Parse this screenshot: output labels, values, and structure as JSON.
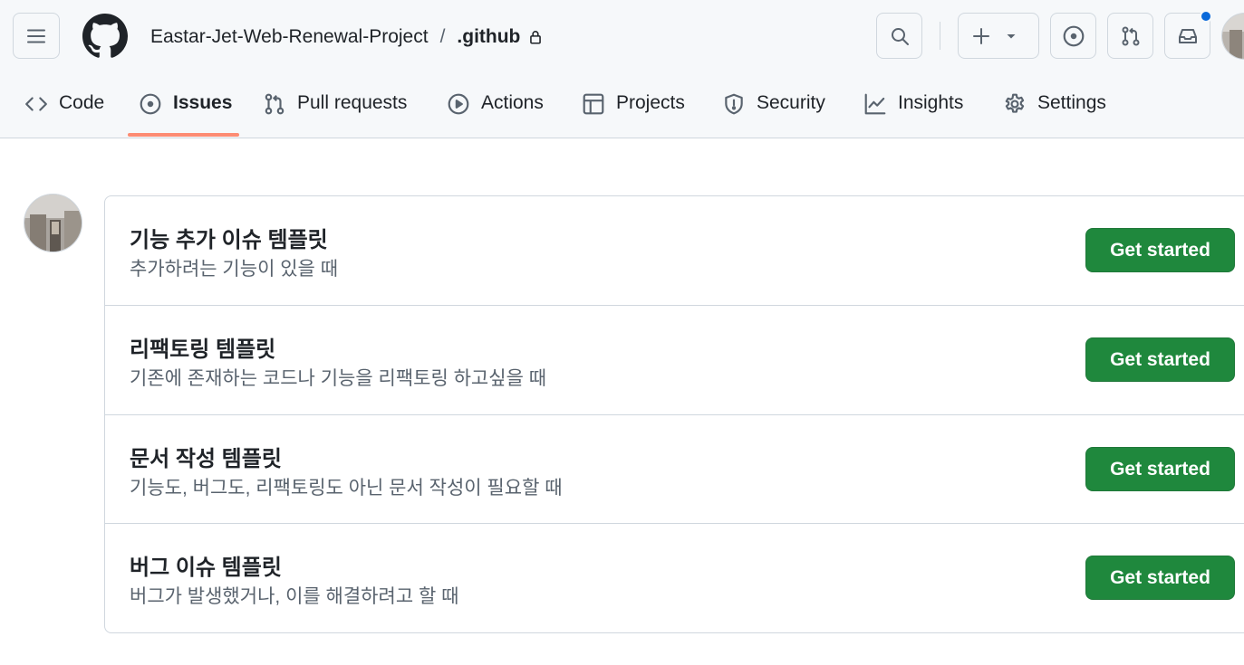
{
  "header": {
    "owner": "Eastar-Jet-Web-Renewal-Project",
    "separator": "/",
    "repo": ".github"
  },
  "tabs": [
    {
      "label": "Code",
      "icon": "code-icon",
      "selected": false
    },
    {
      "label": "Issues",
      "icon": "issue-opened-icon",
      "selected": true
    },
    {
      "label": "Pull requests",
      "icon": "git-pull-request-icon",
      "selected": false
    },
    {
      "label": "Actions",
      "icon": "play-icon",
      "selected": false
    },
    {
      "label": "Projects",
      "icon": "table-icon",
      "selected": false
    },
    {
      "label": "Security",
      "icon": "shield-icon",
      "selected": false
    },
    {
      "label": "Insights",
      "icon": "graph-icon",
      "selected": false
    },
    {
      "label": "Settings",
      "icon": "gear-icon",
      "selected": false
    }
  ],
  "templates": [
    {
      "title": "기능 추가 이슈 템플릿",
      "description": "추가하려는 기능이 있을 때",
      "button": "Get started"
    },
    {
      "title": "리팩토링 템플릿",
      "description": "기존에 존재하는 코드나 기능을 리팩토링 하고싶을 때",
      "button": "Get started"
    },
    {
      "title": "문서 작성 템플릿",
      "description": "기능도, 버그도, 리팩토링도 아닌 문서 작성이 필요할 때",
      "button": "Get started"
    },
    {
      "title": "버그 이슈 템플릿",
      "description": "버그가 발생했거나, 이를 해결하려고 할 때",
      "button": "Get started"
    }
  ],
  "colors": {
    "accent_underline": "#fd8c73",
    "primary_button": "#1f883d",
    "notification_dot": "#0969da"
  }
}
